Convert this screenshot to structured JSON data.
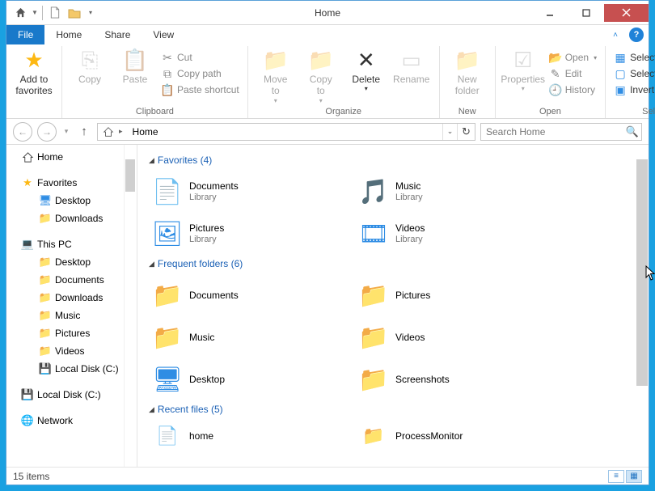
{
  "window": {
    "title": "Home"
  },
  "tabs": {
    "file": "File",
    "home": "Home",
    "share": "Share",
    "view": "View"
  },
  "ribbon": {
    "add_favorites": "Add to\nfavorites",
    "copy": "Copy",
    "paste": "Paste",
    "cut": "Cut",
    "copy_path": "Copy path",
    "paste_shortcut": "Paste shortcut",
    "clipboard_group": "Clipboard",
    "move_to": "Move\nto",
    "copy_to": "Copy\nto",
    "delete": "Delete",
    "rename": "Rename",
    "organize_group": "Organize",
    "new_folder": "New\nfolder",
    "new_group": "New",
    "properties": "Properties",
    "open": "Open",
    "edit": "Edit",
    "history": "History",
    "open_group": "Open",
    "select_all": "Select all",
    "select_none": "Select none",
    "invert": "Invert selection",
    "select_group": "Select"
  },
  "nav": {
    "breadcrumb": "Home",
    "search_placeholder": "Search Home"
  },
  "sidebar": {
    "home": "Home",
    "favorites": "Favorites",
    "desktop": "Desktop",
    "downloads": "Downloads",
    "thispc": "This PC",
    "documents": "Documents",
    "music": "Music",
    "pictures": "Pictures",
    "videos": "Videos",
    "localdisk": "Local Disk (C:)",
    "network": "Network"
  },
  "sections": {
    "favorites": {
      "label": "Favorites (4)",
      "items": [
        {
          "name": "Documents",
          "sub": "Library"
        },
        {
          "name": "Music",
          "sub": "Library"
        },
        {
          "name": "Pictures",
          "sub": "Library"
        },
        {
          "name": "Videos",
          "sub": "Library"
        }
      ]
    },
    "frequent": {
      "label": "Frequent folders (6)",
      "items": [
        {
          "name": "Documents"
        },
        {
          "name": "Pictures"
        },
        {
          "name": "Music"
        },
        {
          "name": "Videos"
        },
        {
          "name": "Desktop"
        },
        {
          "name": "Screenshots"
        }
      ]
    },
    "recent": {
      "label": "Recent files (5)",
      "items": [
        {
          "name": "home"
        },
        {
          "name": "ProcessMonitor"
        }
      ]
    }
  },
  "status": {
    "items": "15 items"
  }
}
